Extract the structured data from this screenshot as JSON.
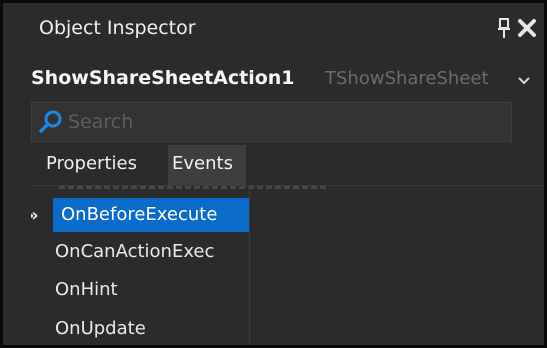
{
  "panel": {
    "title": "Object Inspector",
    "pin_icon": "pin-icon",
    "close_icon": "close-icon"
  },
  "object_selector": {
    "name": "ShowShareSheetAction1",
    "type": "TShowShareSheet",
    "chevron_icon": "chevron-down-icon"
  },
  "search": {
    "placeholder": "Search",
    "icon": "search-icon",
    "value": ""
  },
  "tabs": [
    {
      "label": "Properties",
      "active": false
    },
    {
      "label": "Events",
      "active": true
    }
  ],
  "events": [
    {
      "name": "OnBeforeExecute",
      "value": "",
      "selected": true,
      "marker": "»"
    },
    {
      "name": "OnCanActionExec",
      "value": "",
      "selected": false
    },
    {
      "name": "OnHint",
      "value": "",
      "selected": false
    },
    {
      "name": "OnUpdate",
      "value": "",
      "selected": false
    }
  ],
  "colors": {
    "background": "#2b2b2b",
    "selection": "#0a6bc9",
    "search_icon": "#1e88e5",
    "active_tab": "#3e3e3e",
    "muted_text": "#6c6c6c"
  }
}
